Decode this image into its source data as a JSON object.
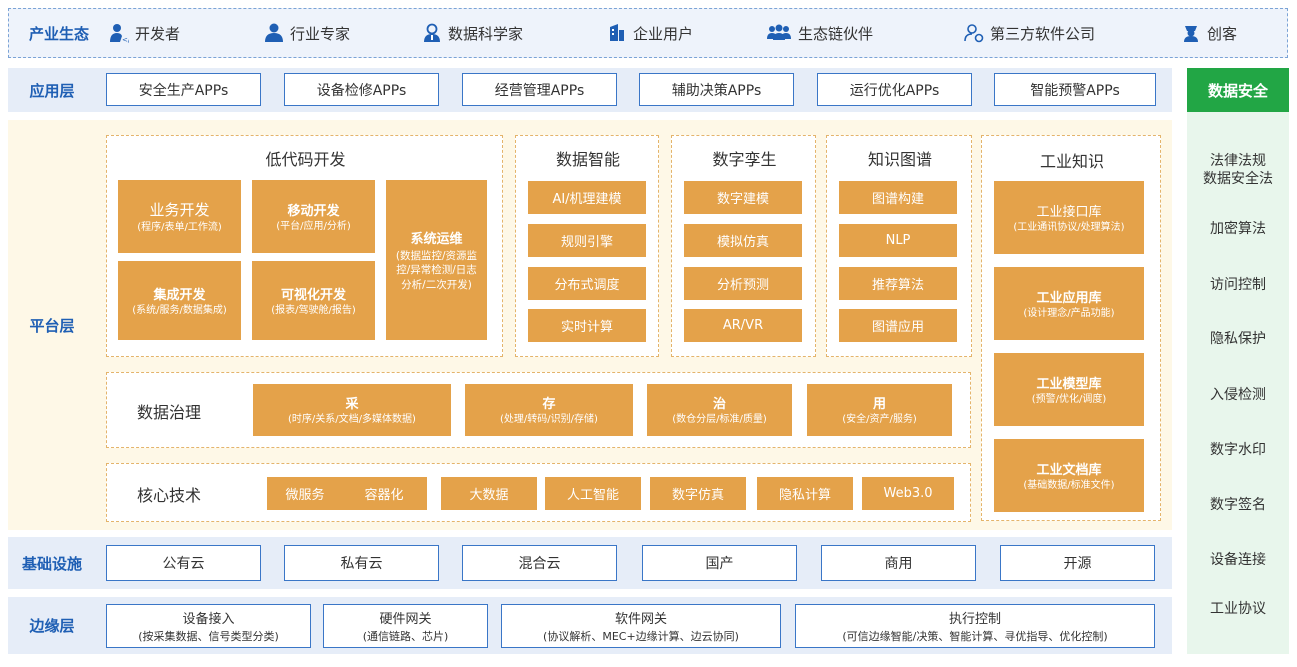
{
  "ecosystem": {
    "label": "产业生态",
    "items": [
      {
        "label": "开发者",
        "icon": "developer-icon"
      },
      {
        "label": "行业专家",
        "icon": "expert-icon"
      },
      {
        "label": "数据科学家",
        "icon": "scientist-icon"
      },
      {
        "label": "企业用户",
        "icon": "enterprise-icon"
      },
      {
        "label": "生态链伙伴",
        "icon": "partners-icon"
      },
      {
        "label": "第三方软件公司",
        "icon": "third-party-icon"
      },
      {
        "label": "创客",
        "icon": "maker-icon"
      }
    ]
  },
  "application": {
    "label": "应用层",
    "items": [
      "安全生产APPs",
      "设备检修APPs",
      "经营管理APPs",
      "辅助决策APPs",
      "运行优化APPs",
      "智能预警APPs"
    ]
  },
  "platform": {
    "label": "平台层",
    "lowcode": {
      "title": "低代码开发",
      "blocks": [
        {
          "title": "业务开发",
          "sub": "(程序/表单/工作流)"
        },
        {
          "title": "移动开发",
          "sub": "(平台/应用/分析)"
        },
        {
          "title": "系统运维",
          "sub": "(数据监控/资源监控/异常检测/日志分析/二次开发)"
        },
        {
          "title": "集成开发",
          "sub": "(系统/服务/数据集成)"
        },
        {
          "title": "可视化开发",
          "sub": "(报表/驾驶舱/报告)"
        }
      ]
    },
    "columns": [
      {
        "title": "数据智能",
        "items": [
          "AI/机理建模",
          "规则引擎",
          "分布式调度",
          "实时计算"
        ]
      },
      {
        "title": "数字孪生",
        "items": [
          "数字建模",
          "模拟仿真",
          "分析预测",
          "AR/VR"
        ]
      },
      {
        "title": "知识图谱",
        "items": [
          "图谱构建",
          "NLP",
          "推荐算法",
          "图谱应用"
        ]
      }
    ],
    "knowledge": {
      "title": "工业知识",
      "items": [
        {
          "title": "工业接口库",
          "sub": "(工业通讯协议/处理算法)"
        },
        {
          "title": "工业应用库",
          "sub": "(设计理念/产品功能)"
        },
        {
          "title": "工业模型库",
          "sub": "(预警/优化/调度)"
        },
        {
          "title": "工业文档库",
          "sub": "(基础数据/标准文件)"
        }
      ]
    },
    "governance": {
      "title": "数据治理",
      "items": [
        {
          "title": "采",
          "sub": "(时序/关系/文档/多媒体数据)"
        },
        {
          "title": "存",
          "sub": "(处理/转码/识别/存储)"
        },
        {
          "title": "治",
          "sub": "(数仓分层/标准/质量)"
        },
        {
          "title": "用",
          "sub": "(安全/资产/服务)"
        }
      ]
    },
    "core": {
      "title": "核心技术",
      "items": [
        "微服务",
        "容器化",
        "大数据",
        "人工智能",
        "数字仿真",
        "隐私计算",
        "Web3.0"
      ]
    }
  },
  "security": {
    "title": "数据安全",
    "items": [
      "法律法规\n数据安全法",
      "加密算法",
      "访问控制",
      "隐私保护",
      "入侵检测",
      "数字水印",
      "数字签名",
      "设备连接",
      "工业协议"
    ]
  },
  "infrastructure": {
    "label": "基础设施",
    "items": [
      "公有云",
      "私有云",
      "混合云",
      "国产",
      "商用",
      "开源"
    ]
  },
  "edge": {
    "label": "边缘层",
    "items": [
      {
        "title": "设备接入",
        "sub": "(按采集数据、信号类型分类)"
      },
      {
        "title": "硬件网关",
        "sub": "(通信链路、芯片)"
      },
      {
        "title": "软件网关",
        "sub": "(协议解析、MEC+边缘计算、边云协同)"
      },
      {
        "title": "执行控制",
        "sub": "(可信边缘智能/决策、智能计算、寻优指导、优化控制)"
      }
    ]
  },
  "colors": {
    "blue": "#1f5fb4",
    "orange": "#e4a24a",
    "green": "#22a645",
    "cream": "#fef8e7"
  }
}
